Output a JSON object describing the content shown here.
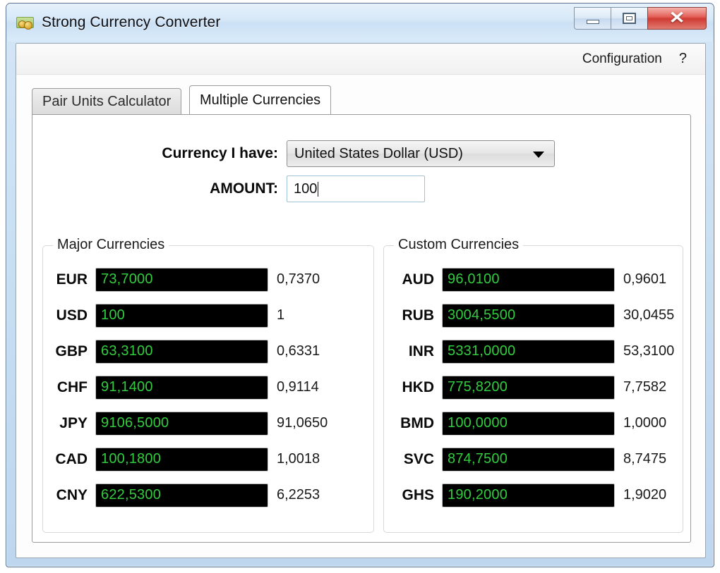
{
  "window": {
    "title": "Strong Currency Converter",
    "icon": "money-icon",
    "controls": {
      "minimize": "minimize-icon",
      "maximize": "maximize-icon",
      "close": "✕"
    }
  },
  "menu": {
    "configuration_label": "Configuration",
    "help_label": "?"
  },
  "tabs": [
    {
      "label": "Pair Units Calculator",
      "active": false
    },
    {
      "label": "Multiple Currencies",
      "active": true
    }
  ],
  "form": {
    "currency_label": "Currency I have:",
    "currency_value": "United States Dollar (USD)",
    "amount_label": "AMOUNT:",
    "amount_value": "100"
  },
  "colors": {
    "field_background": "#000000",
    "field_text": "#32cc3f",
    "titlebar": "#d6e8f8",
    "close_button": "#cf3b33"
  },
  "major_currencies": {
    "title": "Major Currencies",
    "rows": [
      {
        "code": "EUR",
        "amount": "73,7000",
        "rate": "0,7370"
      },
      {
        "code": "USD",
        "amount": "100",
        "rate": "1"
      },
      {
        "code": "GBP",
        "amount": "63,3100",
        "rate": "0,6331"
      },
      {
        "code": "CHF",
        "amount": "91,1400",
        "rate": "0,9114"
      },
      {
        "code": "JPY",
        "amount": "9106,5000",
        "rate": "91,0650"
      },
      {
        "code": "CAD",
        "amount": "100,1800",
        "rate": "1,0018"
      },
      {
        "code": "CNY",
        "amount": "622,5300",
        "rate": "6,2253"
      }
    ]
  },
  "custom_currencies": {
    "title": "Custom Currencies",
    "rows": [
      {
        "code": "AUD",
        "amount": "96,0100",
        "rate": "0,9601"
      },
      {
        "code": "RUB",
        "amount": "3004,5500",
        "rate": "30,0455"
      },
      {
        "code": "INR",
        "amount": "5331,0000",
        "rate": "53,3100"
      },
      {
        "code": "HKD",
        "amount": "775,8200",
        "rate": "7,7582"
      },
      {
        "code": "BMD",
        "amount": "100,0000",
        "rate": "1,0000"
      },
      {
        "code": "SVC",
        "amount": "874,7500",
        "rate": "8,7475"
      },
      {
        "code": "GHS",
        "amount": "190,2000",
        "rate": "1,9020"
      }
    ]
  }
}
